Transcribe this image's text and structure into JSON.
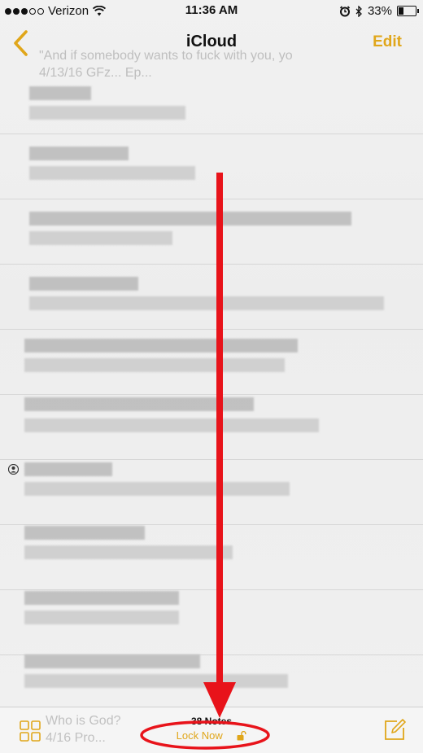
{
  "status_bar": {
    "carrier": "Verizon",
    "time": "11:36 AM",
    "battery": "33%",
    "battery_level": 0.33
  },
  "nav": {
    "title": "iCloud",
    "edit_label": "Edit",
    "ghost_line1": "\"And if somebody wants to fuck with you, yo",
    "ghost_line2": "4/13/16   GFz...   Ep..."
  },
  "toolbar": {
    "notes_count": "38 Notes",
    "lock_label": "Lock Now",
    "ghost_title": "Who is God?",
    "ghost_date": "4/16   Pro..."
  },
  "icons": {
    "back": "chevron-left-icon",
    "gallery": "gallery-grid-icon",
    "compose": "compose-icon",
    "lock": "lock-icon",
    "shared": "shared-person-icon"
  },
  "colors": {
    "accent": "#e0a61a",
    "annotation": "#e8131a"
  }
}
